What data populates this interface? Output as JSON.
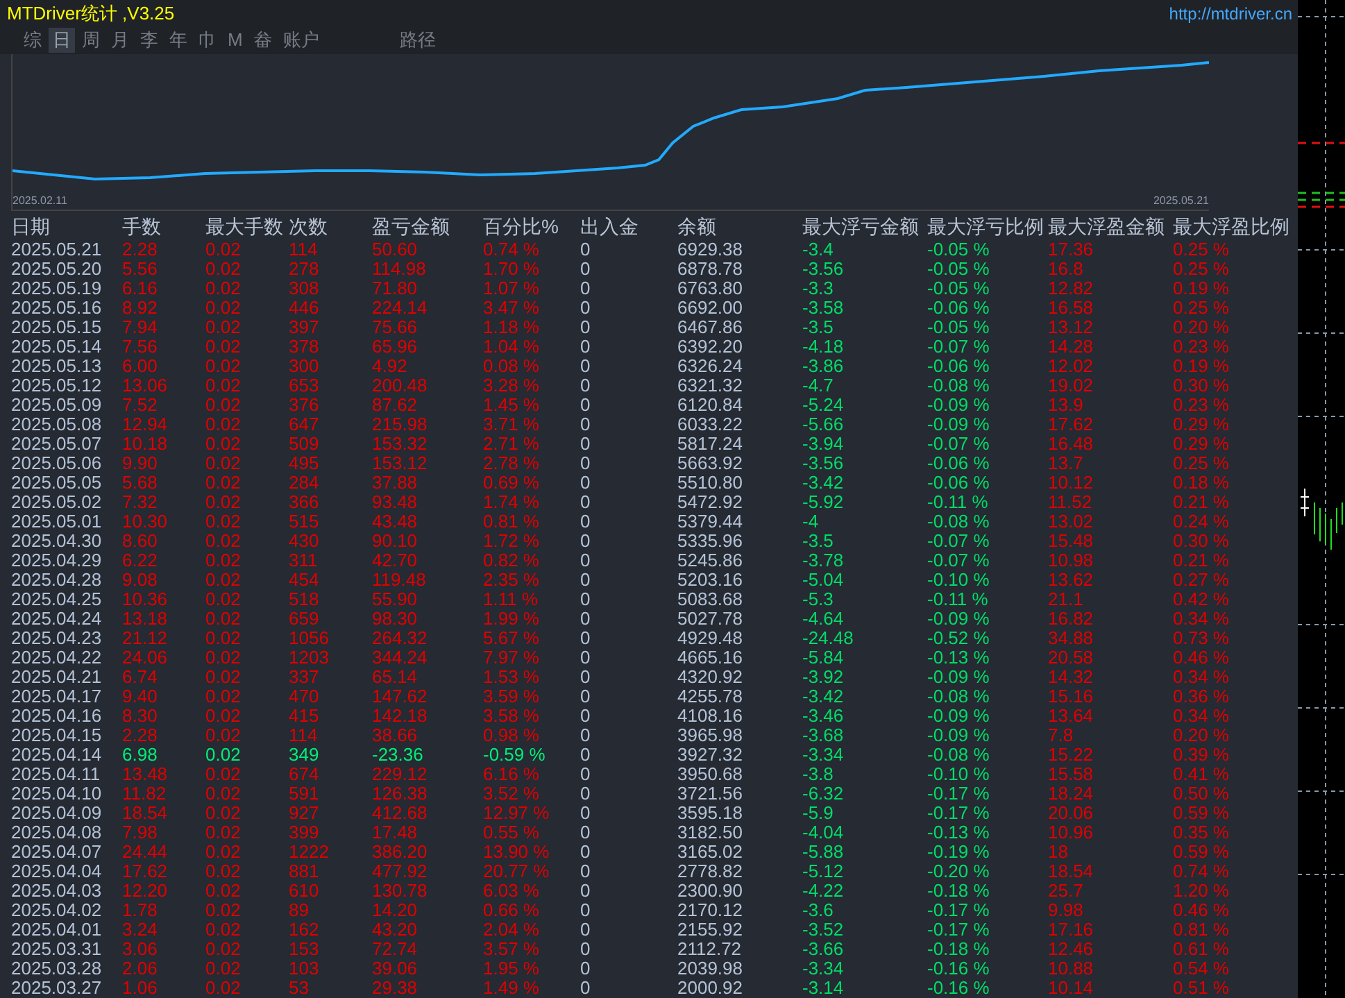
{
  "window": {
    "title": "MTDriver统计 ,V3.25",
    "link": "http://mtdriver.cn"
  },
  "tabs": [
    {
      "label": "综",
      "selected": false
    },
    {
      "label": "日",
      "selected": true
    },
    {
      "label": "周",
      "selected": false
    },
    {
      "label": "月",
      "selected": false
    },
    {
      "label": "李",
      "selected": false
    },
    {
      "label": "年",
      "selected": false
    },
    {
      "label": "巾",
      "selected": false
    },
    {
      "label": "M",
      "selected": false
    },
    {
      "label": "畚",
      "selected": false
    },
    {
      "label": "账户",
      "selected": false
    },
    {
      "label": "路径",
      "selected": false
    }
  ],
  "equity_chart": {
    "start_label": "2025.02.11",
    "end_label": "2025.05.21"
  },
  "table": {
    "columns": [
      "日期",
      "手数",
      "最大手数",
      "次数",
      "盈亏金额",
      "百分比%",
      "出入金",
      "余额",
      "最大浮亏金额",
      "最大浮亏比例",
      "最大浮盈金额",
      "最大浮盈比例"
    ],
    "rows": [
      {
        "loss": false,
        "cells": [
          "2025.05.21",
          "2.28",
          "0.02",
          "114",
          "50.60",
          "0.74 %",
          "0",
          "6929.38",
          "-3.4",
          "-0.05 %",
          "17.36",
          "0.25 %"
        ]
      },
      {
        "loss": false,
        "cells": [
          "2025.05.20",
          "5.56",
          "0.02",
          "278",
          "114.98",
          "1.70 %",
          "0",
          "6878.78",
          "-3.56",
          "-0.05 %",
          "16.8",
          "0.25 %"
        ]
      },
      {
        "loss": false,
        "cells": [
          "2025.05.19",
          "6.16",
          "0.02",
          "308",
          "71.80",
          "1.07 %",
          "0",
          "6763.80",
          "-3.3",
          "-0.05 %",
          "12.82",
          "0.19 %"
        ]
      },
      {
        "loss": false,
        "cells": [
          "2025.05.16",
          "8.92",
          "0.02",
          "446",
          "224.14",
          "3.47 %",
          "0",
          "6692.00",
          "-3.58",
          "-0.06 %",
          "16.58",
          "0.25 %"
        ]
      },
      {
        "loss": false,
        "cells": [
          "2025.05.15",
          "7.94",
          "0.02",
          "397",
          "75.66",
          "1.18 %",
          "0",
          "6467.86",
          "-3.5",
          "-0.05 %",
          "13.12",
          "0.20 %"
        ]
      },
      {
        "loss": false,
        "cells": [
          "2025.05.14",
          "7.56",
          "0.02",
          "378",
          "65.96",
          "1.04 %",
          "0",
          "6392.20",
          "-4.18",
          "-0.07 %",
          "14.28",
          "0.23 %"
        ]
      },
      {
        "loss": false,
        "cells": [
          "2025.05.13",
          "6.00",
          "0.02",
          "300",
          "4.92",
          "0.08 %",
          "0",
          "6326.24",
          "-3.86",
          "-0.06 %",
          "12.02",
          "0.19 %"
        ]
      },
      {
        "loss": false,
        "cells": [
          "2025.05.12",
          "13.06",
          "0.02",
          "653",
          "200.48",
          "3.28 %",
          "0",
          "6321.32",
          "-4.7",
          "-0.08 %",
          "19.02",
          "0.30 %"
        ]
      },
      {
        "loss": false,
        "cells": [
          "2025.05.09",
          "7.52",
          "0.02",
          "376",
          "87.62",
          "1.45 %",
          "0",
          "6120.84",
          "-5.24",
          "-0.09 %",
          "13.9",
          "0.23 %"
        ]
      },
      {
        "loss": false,
        "cells": [
          "2025.05.08",
          "12.94",
          "0.02",
          "647",
          "215.98",
          "3.71 %",
          "0",
          "6033.22",
          "-5.66",
          "-0.09 %",
          "17.62",
          "0.29 %"
        ]
      },
      {
        "loss": false,
        "cells": [
          "2025.05.07",
          "10.18",
          "0.02",
          "509",
          "153.32",
          "2.71 %",
          "0",
          "5817.24",
          "-3.94",
          "-0.07 %",
          "16.48",
          "0.29 %"
        ]
      },
      {
        "loss": false,
        "cells": [
          "2025.05.06",
          "9.90",
          "0.02",
          "495",
          "153.12",
          "2.78 %",
          "0",
          "5663.92",
          "-3.56",
          "-0.06 %",
          "13.7",
          "0.25 %"
        ]
      },
      {
        "loss": false,
        "cells": [
          "2025.05.05",
          "5.68",
          "0.02",
          "284",
          "37.88",
          "0.69 %",
          "0",
          "5510.80",
          "-3.42",
          "-0.06 %",
          "10.12",
          "0.18 %"
        ]
      },
      {
        "loss": false,
        "cells": [
          "2025.05.02",
          "7.32",
          "0.02",
          "366",
          "93.48",
          "1.74 %",
          "0",
          "5472.92",
          "-5.92",
          "-0.11 %",
          "11.52",
          "0.21 %"
        ]
      },
      {
        "loss": false,
        "cells": [
          "2025.05.01",
          "10.30",
          "0.02",
          "515",
          "43.48",
          "0.81 %",
          "0",
          "5379.44",
          "-4",
          "-0.08 %",
          "13.02",
          "0.24 %"
        ]
      },
      {
        "loss": false,
        "cells": [
          "2025.04.30",
          "8.60",
          "0.02",
          "430",
          "90.10",
          "1.72 %",
          "0",
          "5335.96",
          "-3.5",
          "-0.07 %",
          "15.48",
          "0.30 %"
        ]
      },
      {
        "loss": false,
        "cells": [
          "2025.04.29",
          "6.22",
          "0.02",
          "311",
          "42.70",
          "0.82 %",
          "0",
          "5245.86",
          "-3.78",
          "-0.07 %",
          "10.98",
          "0.21 %"
        ]
      },
      {
        "loss": false,
        "cells": [
          "2025.04.28",
          "9.08",
          "0.02",
          "454",
          "119.48",
          "2.35 %",
          "0",
          "5203.16",
          "-5.04",
          "-0.10 %",
          "13.62",
          "0.27 %"
        ]
      },
      {
        "loss": false,
        "cells": [
          "2025.04.25",
          "10.36",
          "0.02",
          "518",
          "55.90",
          "1.11 %",
          "0",
          "5083.68",
          "-5.3",
          "-0.11 %",
          "21.1",
          "0.42 %"
        ]
      },
      {
        "loss": false,
        "cells": [
          "2025.04.24",
          "13.18",
          "0.02",
          "659",
          "98.30",
          "1.99 %",
          "0",
          "5027.78",
          "-4.64",
          "-0.09 %",
          "16.82",
          "0.34 %"
        ]
      },
      {
        "loss": false,
        "cells": [
          "2025.04.23",
          "21.12",
          "0.02",
          "1056",
          "264.32",
          "5.67 %",
          "0",
          "4929.48",
          "-24.48",
          "-0.52 %",
          "34.88",
          "0.73 %"
        ]
      },
      {
        "loss": false,
        "cells": [
          "2025.04.22",
          "24.06",
          "0.02",
          "1203",
          "344.24",
          "7.97 %",
          "0",
          "4665.16",
          "-5.84",
          "-0.13 %",
          "20.58",
          "0.46 %"
        ]
      },
      {
        "loss": false,
        "cells": [
          "2025.04.21",
          "6.74",
          "0.02",
          "337",
          "65.14",
          "1.53 %",
          "0",
          "4320.92",
          "-3.92",
          "-0.09 %",
          "14.32",
          "0.34 %"
        ]
      },
      {
        "loss": false,
        "cells": [
          "2025.04.17",
          "9.40",
          "0.02",
          "470",
          "147.62",
          "3.59 %",
          "0",
          "4255.78",
          "-3.42",
          "-0.08 %",
          "15.16",
          "0.36 %"
        ]
      },
      {
        "loss": false,
        "cells": [
          "2025.04.16",
          "8.30",
          "0.02",
          "415",
          "142.18",
          "3.58 %",
          "0",
          "4108.16",
          "-3.46",
          "-0.09 %",
          "13.64",
          "0.34 %"
        ]
      },
      {
        "loss": false,
        "cells": [
          "2025.04.15",
          "2.28",
          "0.02",
          "114",
          "38.66",
          "0.98 %",
          "0",
          "3965.98",
          "-3.68",
          "-0.09 %",
          "7.8",
          "0.20 %"
        ]
      },
      {
        "loss": true,
        "cells": [
          "2025.04.14",
          "6.98",
          "0.02",
          "349",
          "-23.36",
          "-0.59 %",
          "0",
          "3927.32",
          "-3.34",
          "-0.08 %",
          "15.22",
          "0.39 %"
        ]
      },
      {
        "loss": false,
        "cells": [
          "2025.04.11",
          "13.48",
          "0.02",
          "674",
          "229.12",
          "6.16 %",
          "0",
          "3950.68",
          "-3.8",
          "-0.10 %",
          "15.58",
          "0.41 %"
        ]
      },
      {
        "loss": false,
        "cells": [
          "2025.04.10",
          "11.82",
          "0.02",
          "591",
          "126.38",
          "3.52 %",
          "0",
          "3721.56",
          "-6.32",
          "-0.17 %",
          "18.24",
          "0.50 %"
        ]
      },
      {
        "loss": false,
        "cells": [
          "2025.04.09",
          "18.54",
          "0.02",
          "927",
          "412.68",
          "12.97 %",
          "0",
          "3595.18",
          "-5.9",
          "-0.17 %",
          "20.06",
          "0.59 %"
        ]
      },
      {
        "loss": false,
        "cells": [
          "2025.04.08",
          "7.98",
          "0.02",
          "399",
          "17.48",
          "0.55 %",
          "0",
          "3182.50",
          "-4.04",
          "-0.13 %",
          "10.96",
          "0.35 %"
        ]
      },
      {
        "loss": false,
        "cells": [
          "2025.04.07",
          "24.44",
          "0.02",
          "1222",
          "386.20",
          "13.90 %",
          "0",
          "3165.02",
          "-5.88",
          "-0.19 %",
          "18",
          "0.59 %"
        ]
      },
      {
        "loss": false,
        "cells": [
          "2025.04.04",
          "17.62",
          "0.02",
          "881",
          "477.92",
          "20.77 %",
          "0",
          "2778.82",
          "-5.12",
          "-0.20 %",
          "18.54",
          "0.74 %"
        ]
      },
      {
        "loss": false,
        "cells": [
          "2025.04.03",
          "12.20",
          "0.02",
          "610",
          "130.78",
          "6.03 %",
          "0",
          "2300.90",
          "-4.22",
          "-0.18 %",
          "25.7",
          "1.20 %"
        ]
      },
      {
        "loss": false,
        "cells": [
          "2025.04.02",
          "1.78",
          "0.02",
          "89",
          "14.20",
          "0.66 %",
          "0",
          "2170.12",
          "-3.6",
          "-0.17 %",
          "9.98",
          "0.46 %"
        ]
      },
      {
        "loss": false,
        "cells": [
          "2025.04.01",
          "3.24",
          "0.02",
          "162",
          "43.20",
          "2.04 %",
          "0",
          "2155.92",
          "-3.52",
          "-0.17 %",
          "17.16",
          "0.81 %"
        ]
      },
      {
        "loss": false,
        "cells": [
          "2025.03.31",
          "3.06",
          "0.02",
          "153",
          "72.74",
          "3.57 %",
          "0",
          "2112.72",
          "-3.66",
          "-0.18 %",
          "12.46",
          "0.61 %"
        ]
      },
      {
        "loss": false,
        "cells": [
          "2025.03.28",
          "2.06",
          "0.02",
          "103",
          "39.06",
          "1.95 %",
          "0",
          "2039.98",
          "-3.34",
          "-0.16 %",
          "10.88",
          "0.54 %"
        ]
      },
      {
        "loss": false,
        "cells": [
          "2025.03.27",
          "1.06",
          "0.02",
          "53",
          "29.38",
          "1.49 %",
          "0",
          "2000.92",
          "-3.14",
          "-0.16 %",
          "10.14",
          "0.51 %"
        ]
      }
    ]
  }
}
